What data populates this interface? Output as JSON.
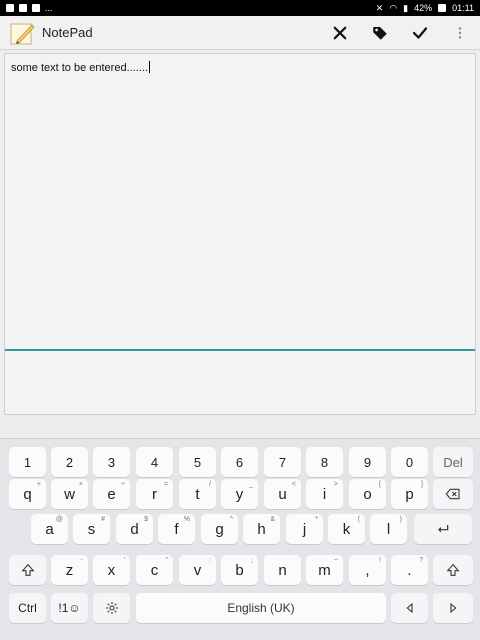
{
  "status_bar": {
    "left": "...",
    "battery": "42%",
    "time": "01:11"
  },
  "app": {
    "title": "NotePad",
    "accent_color": "#2a9a9a"
  },
  "editor": {
    "text": "some text to be entered......."
  },
  "toolbar": {
    "icons": [
      "close-icon",
      "tag-icon",
      "check-icon",
      "more-vert-icon"
    ]
  },
  "keyboard": {
    "row1": [
      "1",
      "2",
      "3",
      "4",
      "5",
      "6",
      "7",
      "8",
      "9",
      "0",
      "Del"
    ],
    "row2": {
      "keys": [
        "q",
        "w",
        "e",
        "r",
        "t",
        "y",
        "u",
        "i",
        "o",
        "p"
      ],
      "hints": [
        "+",
        "×",
        "÷",
        "=",
        "/",
        "_",
        "<",
        ">",
        "[",
        "]"
      ]
    },
    "row3": {
      "keys": [
        "a",
        "s",
        "d",
        "f",
        "g",
        "h",
        "j",
        "k",
        "l"
      ],
      "hints": [
        "@",
        "#",
        "$",
        "%",
        "^",
        "&",
        "*",
        "(",
        ")"
      ]
    },
    "row4": {
      "keys": [
        "z",
        "x",
        "c",
        "v",
        "b",
        "n",
        "m",
        ",",
        ".",
        ""
      ],
      "hints": [
        "-",
        "'",
        "\"",
        ":",
        ";",
        "",
        "~",
        "!",
        "?",
        ""
      ]
    },
    "row5": {
      "ctrl": "Ctrl",
      "symbols": "!1☺",
      "space": "English (UK)"
    }
  }
}
